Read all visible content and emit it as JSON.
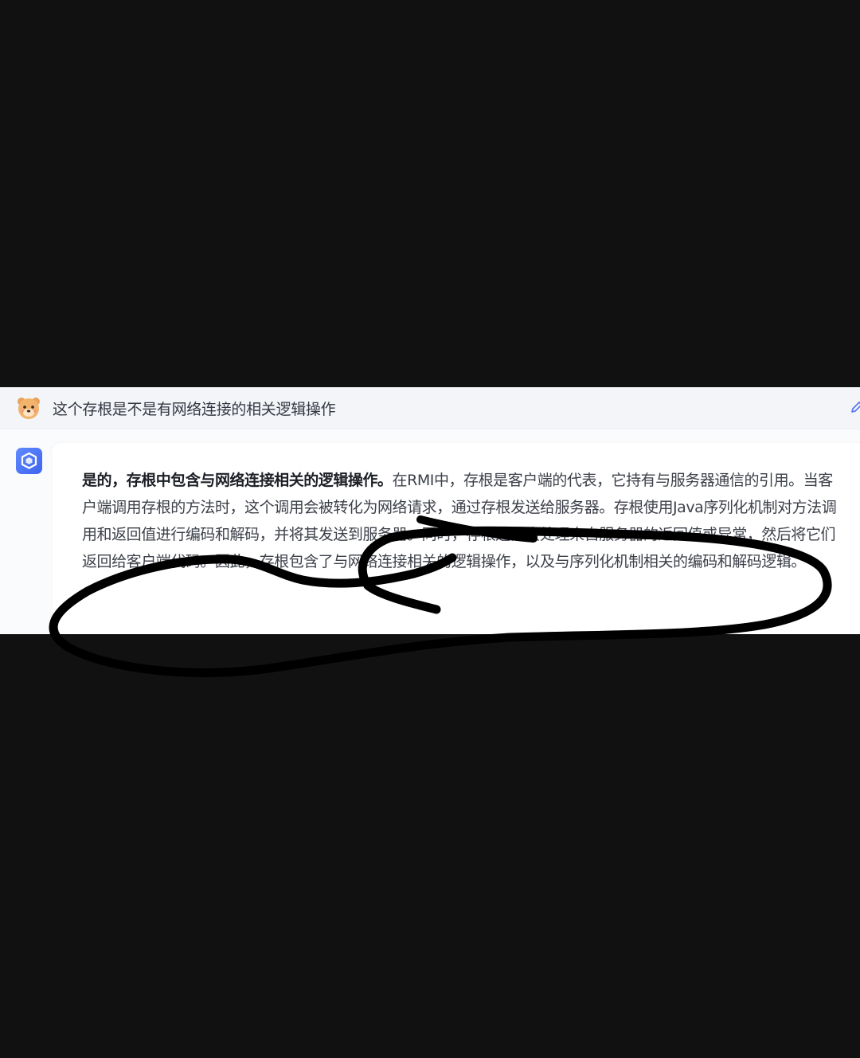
{
  "conversation": {
    "question": "这个存根是不是有网络连接的相关逻辑操作",
    "answer": {
      "lead_bold": "是的，存根中包含与网络连接相关的逻辑操作。",
      "body": "在RMI中，存根是客户端的代表，它持有与服务器通信的引用。当客户端调用存根的方法时，这个调用会被转化为网络请求，通过存根发送给服务器。存根使用Java序列化机制对方法调用和返回值进行编码和解码，并将其发送到服务器。同时，存根还负责处理来自服务器的返回值或异常，然后将它们返回给客户端代码。因此，存根包含了与网络连接相关的逻辑操作，以及与序列化机制相关的编码和解码逻辑。"
    }
  },
  "icons": {
    "user_avatar": "cartoon-bear-avatar-icon",
    "assistant_avatar": "cube-logo-icon",
    "edit": "pencil-edit-icon"
  },
  "colors": {
    "page_background": "#111111",
    "assistant_accent": "#4a6ef5",
    "scribble": "#000000"
  }
}
